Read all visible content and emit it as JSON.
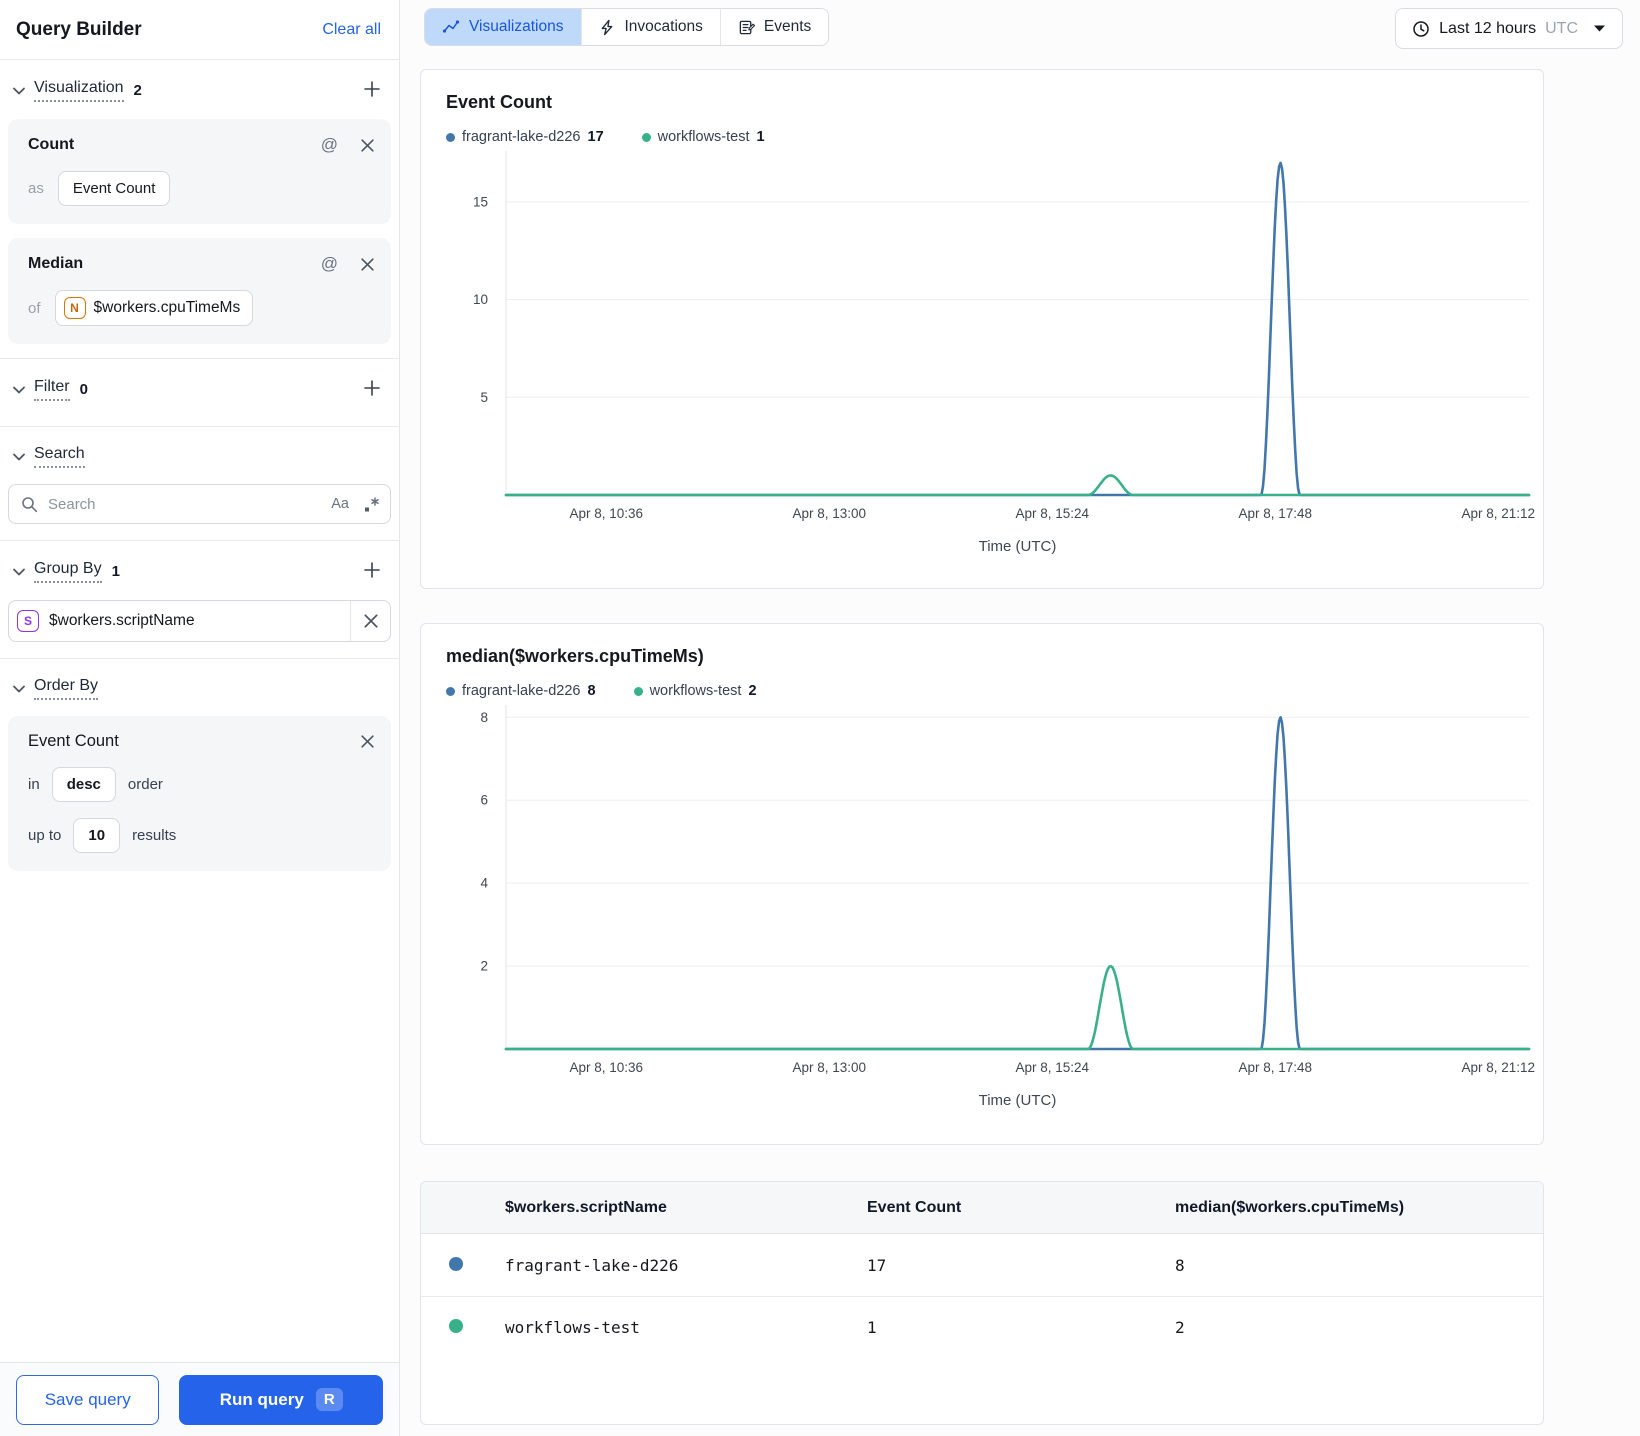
{
  "sidebar": {
    "title": "Query Builder",
    "clear_all": "Clear all",
    "sections": {
      "visualization": {
        "label": "Visualization",
        "count": "2"
      },
      "filter": {
        "label": "Filter",
        "count": "0"
      },
      "search": {
        "label": "Search"
      },
      "group_by": {
        "label": "Group By",
        "count": "1"
      },
      "order_by": {
        "label": "Order By"
      }
    },
    "visualizations": [
      {
        "title": "Count",
        "prefix": "as",
        "value": "Event Count"
      },
      {
        "title": "Median",
        "prefix": "of",
        "badge": "N",
        "value": "$workers.cpuTimeMs"
      }
    ],
    "search": {
      "placeholder": "Search",
      "match_case": "Aa"
    },
    "group_by_chip": {
      "badge": "S",
      "value": "$workers.scriptName"
    },
    "order_by_card": {
      "title": "Event Count",
      "in_label": "in",
      "direction": "desc",
      "order_label": "order",
      "up_to_label": "up to",
      "limit": "10",
      "results_label": "results"
    },
    "save_button": "Save query",
    "run_button": "Run query",
    "run_shortcut": "R"
  },
  "topbar": {
    "tabs": [
      {
        "label": "Visualizations",
        "icon": "line-chart-icon",
        "active": true
      },
      {
        "label": "Invocations",
        "icon": "lightning-icon",
        "active": false
      },
      {
        "label": "Events",
        "icon": "events-note-icon",
        "active": false
      }
    ],
    "time_range": {
      "label": "Last 12 hours",
      "timezone": "UTC",
      "icon": "clock-icon"
    }
  },
  "chart_data": [
    {
      "type": "line",
      "title": "Event Count",
      "xlabel": "Time (UTC)",
      "x_ticks": [
        "Apr 8, 10:36",
        "Apr 8, 13:00",
        "Apr 8, 15:24",
        "Apr 8, 17:48",
        "Apr 8, 21:12"
      ],
      "x_tick_fractions": [
        0.098,
        0.316,
        0.534,
        0.752,
        0.97
      ],
      "y_ticks": [
        5,
        10,
        15
      ],
      "ylim": [
        0,
        17.4
      ],
      "grid": true,
      "legend": [
        {
          "name": "fragrant-lake-d226",
          "value": "17",
          "color": "#4277ac"
        },
        {
          "name": "workflows-test",
          "value": "1",
          "color": "#38b18a"
        }
      ],
      "series": [
        {
          "name": "fragrant-lake-d226",
          "color": "#4277ac",
          "baseline": 0,
          "peaks": [
            {
              "x": 0.757,
              "value": 17,
              "halfwidth": 0.019
            }
          ]
        },
        {
          "name": "workflows-test",
          "color": "#38b18a",
          "baseline": 0,
          "peaks": [
            {
              "x": 0.591,
              "value": 1,
              "halfwidth": 0.022
            }
          ]
        }
      ]
    },
    {
      "type": "line",
      "title": "median($workers.cpuTimeMs)",
      "xlabel": "Time (UTC)",
      "x_ticks": [
        "Apr 8, 10:36",
        "Apr 8, 13:00",
        "Apr 8, 15:24",
        "Apr 8, 17:48",
        "Apr 8, 21:12"
      ],
      "x_tick_fractions": [
        0.098,
        0.316,
        0.534,
        0.752,
        0.97
      ],
      "y_ticks": [
        2,
        4,
        6,
        8
      ],
      "ylim": [
        0,
        8.2
      ],
      "grid": true,
      "legend": [
        {
          "name": "fragrant-lake-d226",
          "value": "8",
          "color": "#4277ac"
        },
        {
          "name": "workflows-test",
          "value": "2",
          "color": "#38b18a"
        }
      ],
      "series": [
        {
          "name": "fragrant-lake-d226",
          "color": "#4277ac",
          "baseline": 0,
          "peaks": [
            {
              "x": 0.757,
              "value": 8,
              "halfwidth": 0.019
            }
          ]
        },
        {
          "name": "workflows-test",
          "color": "#38b18a",
          "baseline": 0,
          "peaks": [
            {
              "x": 0.591,
              "value": 2,
              "halfwidth": 0.022
            }
          ]
        }
      ]
    }
  ],
  "table": {
    "columns": [
      "$workers.scriptName",
      "Event Count",
      "median($workers.cpuTimeMs)"
    ],
    "rows": [
      {
        "color": "#4277ac",
        "name": "fragrant-lake-d226",
        "event_count": "17",
        "median": "8"
      },
      {
        "color": "#38b18a",
        "name": "workflows-test",
        "event_count": "1",
        "median": "2"
      }
    ]
  }
}
